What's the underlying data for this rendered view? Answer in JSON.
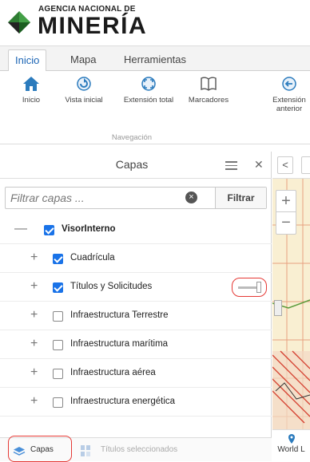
{
  "brand": {
    "top": "AGENCIA NACIONAL DE",
    "name": "MINERÍA"
  },
  "tabs": [
    "Inicio",
    "Mapa",
    "Herramientas"
  ],
  "ribbon": {
    "buttons": [
      {
        "label": "Inicio",
        "icon": "home-icon"
      },
      {
        "label": "Vista inicial",
        "icon": "refresh-icon"
      },
      {
        "label": "Extensión total",
        "icon": "full-extent-icon"
      },
      {
        "label": "Marcadores",
        "icon": "bookmark-book-icon"
      },
      {
        "label": "Extensión",
        "label2": "anterior",
        "icon": "back-arrow-icon"
      }
    ],
    "group_label": "Navegación"
  },
  "panel": {
    "title": "Capas",
    "filter_placeholder": "Filtrar capas ...",
    "filter_button": "Filtrar",
    "root": {
      "label": "VisorInterno",
      "checked": true
    },
    "layers": [
      {
        "label": "Cuadrícula",
        "checked": true
      },
      {
        "label": "Títulos y Solicitudes",
        "checked": true
      },
      {
        "label": "Infraestructura Terrestre",
        "checked": false
      },
      {
        "label": "Infraestructura marítima",
        "checked": false
      },
      {
        "label": "Infraestructura aérea",
        "checked": false
      },
      {
        "label": "Infraestructura energética",
        "checked": false
      }
    ],
    "bottom_tabs": [
      "Capas",
      "Títulos seleccionados"
    ]
  },
  "map": {
    "basemap_label": "World L"
  },
  "colors": {
    "accent": "#1a73e8",
    "highlight_ring": "#e53935",
    "brand_green": "#2e7d32",
    "map_bg": "#f9efd2"
  }
}
